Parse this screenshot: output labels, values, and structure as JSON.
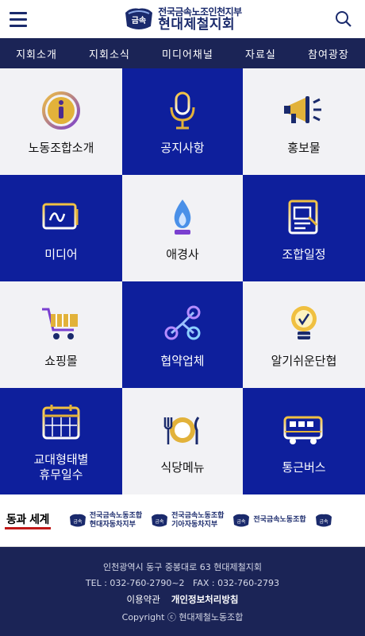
{
  "header": {
    "logo_badge": "금속",
    "logo_line1": "전국금속노조인천지부",
    "logo_line2": "현대제철지회"
  },
  "nav": [
    "지회소개",
    "지회소식",
    "미디어채널",
    "자료실",
    "참여광장"
  ],
  "tiles": [
    {
      "label": "노동조합소개",
      "icon": "info-icon"
    },
    {
      "label": "공지사항",
      "icon": "microphone-icon"
    },
    {
      "label": "홍보물",
      "icon": "megaphone-icon"
    },
    {
      "label": "미디어",
      "icon": "media-screen-icon"
    },
    {
      "label": "애경사",
      "icon": "flame-icon"
    },
    {
      "label": "조합일정",
      "icon": "schedule-doc-icon"
    },
    {
      "label": "쇼핑몰",
      "icon": "shopping-cart-icon"
    },
    {
      "label": "협약업체",
      "icon": "network-nodes-icon"
    },
    {
      "label": "알기쉬운단협",
      "icon": "lightbulb-icon"
    },
    {
      "label": "교대형태별\n휴무일수",
      "icon": "calendar-icon"
    },
    {
      "label": "식당메뉴",
      "icon": "dining-icon"
    },
    {
      "label": "통근버스",
      "icon": "bus-icon"
    }
  ],
  "partners": {
    "segye": "동과 세계",
    "p1_line1": "전국금속노동조합",
    "p1_line2": "현대자동차지부",
    "p2_line1": "전국금속노동조합",
    "p2_line2": "기아자동차지부",
    "p3_line1": "전국금속노동조합",
    "badge": "금속"
  },
  "footer": {
    "address": "인천광역시 동구 중봉대로 63 현대제철지회",
    "tel_fax": "TEL : 032-760-2790~2   FAX : 032-760-2793",
    "terms": "이용약관",
    "privacy": "개인정보처리방침",
    "copyright": "Copyright ⓒ 현대제철노동조합"
  },
  "colors": {
    "navy": "#1b2456",
    "tile_blue": "#0e1f9c",
    "tile_white": "#f2f2f5",
    "gold": "#e2b23a"
  }
}
